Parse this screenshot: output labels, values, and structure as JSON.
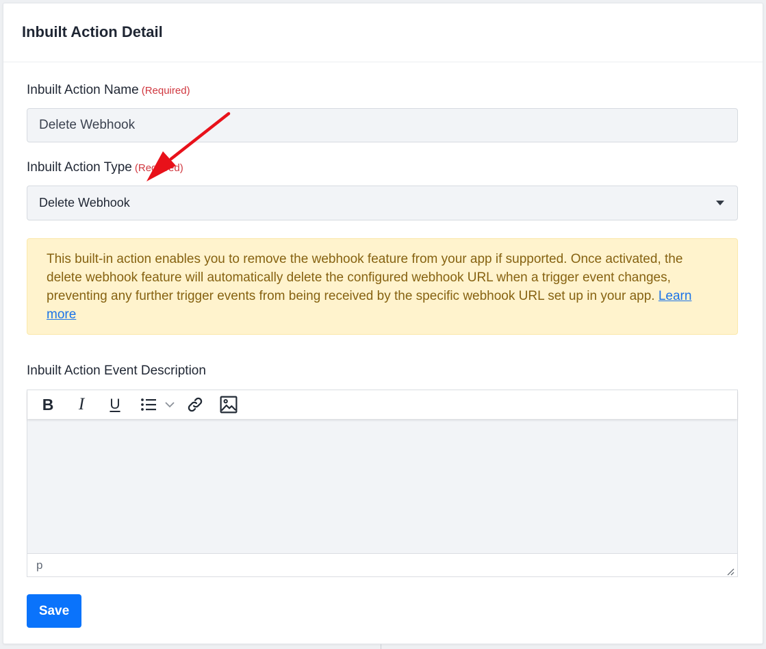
{
  "card": {
    "title": "Inbuilt Action Detail"
  },
  "form": {
    "name_label": "Inbuilt Action Name",
    "name_required": "(Required)",
    "name_value": "Delete Webhook",
    "type_label": "Inbuilt Action Type",
    "type_required": "(Required)",
    "type_selected": "Delete Webhook",
    "description_label": "Inbuilt Action Event Description"
  },
  "alert": {
    "text": "This built-in action enables you to remove the webhook feature from your app if supported. Once activated, the delete webhook feature will automatically delete the configured webhook URL when a trigger event changes, preventing any further trigger events from being received by the specific webhook URL set up in your app. ",
    "link_label": "Learn more"
  },
  "editor": {
    "toolbar": {
      "bold": "B",
      "italic": "I",
      "underline": "U"
    },
    "status_path": "p"
  },
  "actions": {
    "save_label": "Save"
  },
  "colors": {
    "primary": "#0a73fb",
    "required": "#d0373f",
    "alert_background": "#fff3cd",
    "alert_text": "#866211",
    "annotation_arrow": "#e8111a"
  },
  "icons": {
    "list": "bulleted-list-icon",
    "dropdown": "chevron-down-icon",
    "link": "link-icon",
    "image": "image-icon",
    "select_caret": "caret-down-icon"
  }
}
